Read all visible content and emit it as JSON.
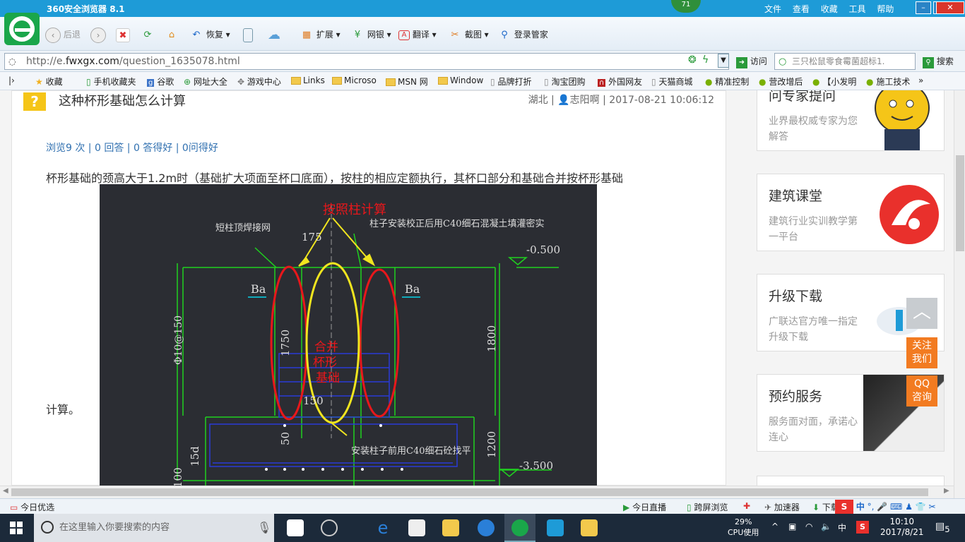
{
  "browser": {
    "title": "360安全浏览器 8.1",
    "counter": "71",
    "menu": [
      "文件",
      "查看",
      "收藏",
      "工具",
      "帮助"
    ]
  },
  "toolbar": {
    "back": "后退",
    "restore": "恢复",
    "extend": "扩展",
    "bank": "网银",
    "translate": "翻译",
    "screenshot": "截图",
    "login": "登录管家"
  },
  "address": {
    "url_prefix": "http://e.",
    "url_domain": "fwxgx.com",
    "url_path": "/question_1635078.html",
    "visit": "访问",
    "search_value": "三只松鼠零食霉菌超标1.",
    "search_button": "搜索"
  },
  "bookmarks": [
    "收藏",
    "手机收藏夹",
    "谷歌",
    "网址大全",
    "游戏中心",
    "Links",
    "Microso",
    "MSN 网",
    "Window",
    "品牌打折",
    "淘宝团购",
    "外国网友",
    "天猫商城",
    "精准控制",
    "营改增后",
    "【小发明",
    "施工技术"
  ],
  "question": {
    "title": "这种杯形基础怎么计算",
    "region": "湖北",
    "author": "志阳啊",
    "datetime": "2017-08-21 10:06:12",
    "stats": "浏览9 次 | 0 回答 | 0 答得好 | 0问得好",
    "body_1": "杯形基础的颈高大于1.2m时（基础扩大项面至杯口底面），按柱的相应定额执行，其杯口部分和基础合并按杯形基础",
    "body_2": "计算。"
  },
  "drawing": {
    "label_column": "按照柱计算",
    "label_merge_1": "合并",
    "label_merge_2": "杯形",
    "label_merge_3": "基础",
    "note_top_left": "短柱顶焊接网",
    "note_top_right": "柱子安装校正后用C40细石混凝土填灌密实",
    "note_bottom": "安装柱子前用C40细石砼找平",
    "elev_top": "-0.500",
    "elev_bottom": "-3.500",
    "dim_175": "175",
    "dim_1750": "1750",
    "dim_1800": "1800",
    "dim_1200": "1200",
    "dim_150": "150",
    "dim_50": "50",
    "dim_15d": "15d",
    "dim_100": "100",
    "rebar": "Φ10@150",
    "ba_left": "Ba",
    "ba_right": "Ba"
  },
  "sidebar": [
    {
      "title": "问专家提问",
      "desc": "业界最权威专家为您解答"
    },
    {
      "title": "建筑课堂",
      "desc": "建筑行业实训教学第一平台"
    },
    {
      "title": "升级下载",
      "desc": "广联达官方唯一指定升级下载"
    },
    {
      "title": "预约服务",
      "desc": "服务面对面，承诺心连心"
    }
  ],
  "float_buttons": {
    "follow": "关注我们",
    "qq": "QQ咨询"
  },
  "statusbar": {
    "left": "今日优选",
    "live": "今日直播",
    "cross_screen": "跨屏浏览",
    "accelerator": "加速器",
    "download": "下载",
    "ime": "中"
  },
  "taskbar": {
    "search_placeholder": "在这里输入你要搜索的内容",
    "cpu_percent": "29%",
    "cpu_label": "CPU使用",
    "ime": "中",
    "time": "10:10",
    "date": "2017/8/21",
    "notifications": "5"
  },
  "colors": {
    "titlebar": "#1e9bd7",
    "logo": "#1aa64a",
    "accent_orange": "#f27b21",
    "cad_bg": "#2b2d33"
  }
}
